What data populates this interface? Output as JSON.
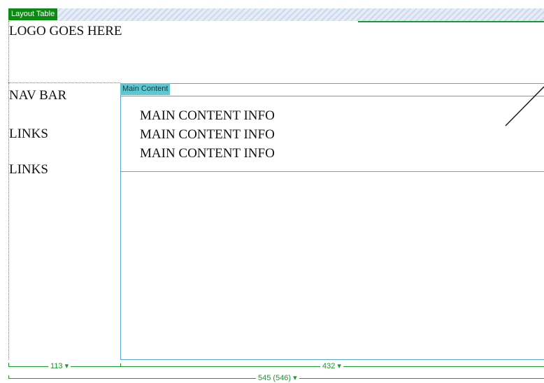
{
  "layout_table": {
    "tab_label": "Layout Table"
  },
  "header": {
    "logo_text": "LOGO GOES HERE"
  },
  "nav": {
    "title": "NAV BAR",
    "links": [
      "LINKS",
      "LINKS"
    ]
  },
  "main": {
    "tab_label": "Main Content",
    "lines": [
      "MAIN CONTENT INFO",
      "MAIN CONTENT INFO",
      "MAIN CONTENT INFO"
    ]
  },
  "rulers": {
    "nav_width": "113 ▾",
    "main_width": "432 ▾",
    "table_width": "545 (546) ▾"
  },
  "colors": {
    "layout_green": "#0d8a12",
    "cell_blue": "#57a6d6",
    "tab_teal": "#5ec7cf"
  }
}
